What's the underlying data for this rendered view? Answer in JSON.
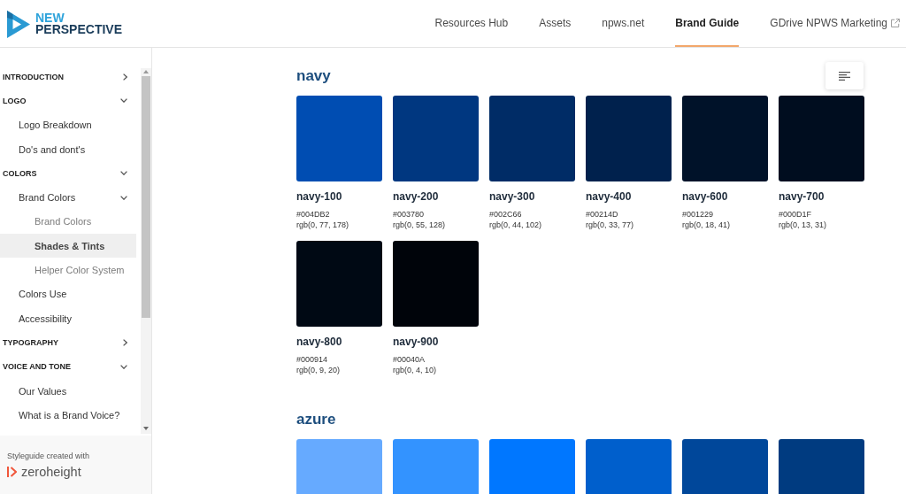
{
  "header": {
    "logo": {
      "line_1": "NEW",
      "line_2": "PERSPECTIVE"
    },
    "nav": [
      {
        "label": "Resources Hub",
        "selected": false,
        "external": false
      },
      {
        "label": "Assets",
        "selected": false,
        "external": false
      },
      {
        "label": "npws.net",
        "selected": false,
        "external": false
      },
      {
        "label": "Brand Guide",
        "selected": true,
        "external": false
      },
      {
        "label": "GDrive NPWS Marketing",
        "selected": false,
        "external": true
      }
    ]
  },
  "sidebar": {
    "items": [
      {
        "label": "INTRODUCTION",
        "selected": false,
        "expanded": false
      },
      {
        "label": "LOGO",
        "selected": false,
        "expanded": true,
        "children": [
          {
            "label": "Logo Breakdown",
            "selected": false
          },
          {
            "label": "Do's and dont's",
            "selected": false
          }
        ]
      },
      {
        "label": "COLORS",
        "selected": false,
        "expanded": true,
        "children": [
          {
            "label": "Brand Colors",
            "selected": false,
            "expanded": true,
            "children": [
              {
                "label": "Brand Colors",
                "selected": false
              },
              {
                "label": "Shades & Tints",
                "selected": true
              },
              {
                "label": "Helper Color System",
                "selected": false
              }
            ]
          },
          {
            "label": "Colors Use",
            "selected": false
          },
          {
            "label": "Accessibility",
            "selected": false
          }
        ]
      },
      {
        "label": "TYPOGRAPHY",
        "selected": false,
        "expanded": false
      },
      {
        "label": "VOICE AND TONE",
        "selected": false,
        "expanded": true,
        "children": [
          {
            "label": "Our Values",
            "selected": false
          },
          {
            "label": "What is a Brand Voice?",
            "selected": false
          }
        ]
      }
    ],
    "footer": {
      "caption": "Styleguide created with",
      "brand": "zeroheight"
    }
  },
  "palettes": [
    {
      "name": "navy",
      "swatches": [
        {
          "name": "navy-100",
          "hex": "#004DB2",
          "rgb": "rgb(0, 77, 178)",
          "color": "#004db2"
        },
        {
          "name": "navy-200",
          "hex": "#003780",
          "rgb": "rgb(0, 55, 128)",
          "color": "#003780"
        },
        {
          "name": "navy-300",
          "hex": "#002C66",
          "rgb": "rgb(0, 44, 102)",
          "color": "#002c66"
        },
        {
          "name": "navy-400",
          "hex": "#00214D",
          "rgb": "rgb(0, 33, 77)",
          "color": "#00214d"
        },
        {
          "name": "navy-600",
          "hex": "#001229",
          "rgb": "rgb(0, 18, 41)",
          "color": "#001229"
        },
        {
          "name": "navy-700",
          "hex": "#000D1F",
          "rgb": "rgb(0, 13, 31)",
          "color": "#000d1f"
        },
        {
          "name": "navy-800",
          "hex": "#000914",
          "rgb": "rgb(0, 9, 20)",
          "color": "#000914"
        },
        {
          "name": "navy-900",
          "hex": "#00040A",
          "rgb": "rgb(0, 4, 10)",
          "color": "#00040a"
        }
      ]
    },
    {
      "name": "azure",
      "swatches": [
        {
          "color": "#66aaff"
        },
        {
          "color": "#3393ff"
        },
        {
          "color": "#0077ff"
        },
        {
          "color": "#005fcc"
        },
        {
          "color": "#00479a"
        },
        {
          "color": "#003b80"
        }
      ]
    }
  ]
}
